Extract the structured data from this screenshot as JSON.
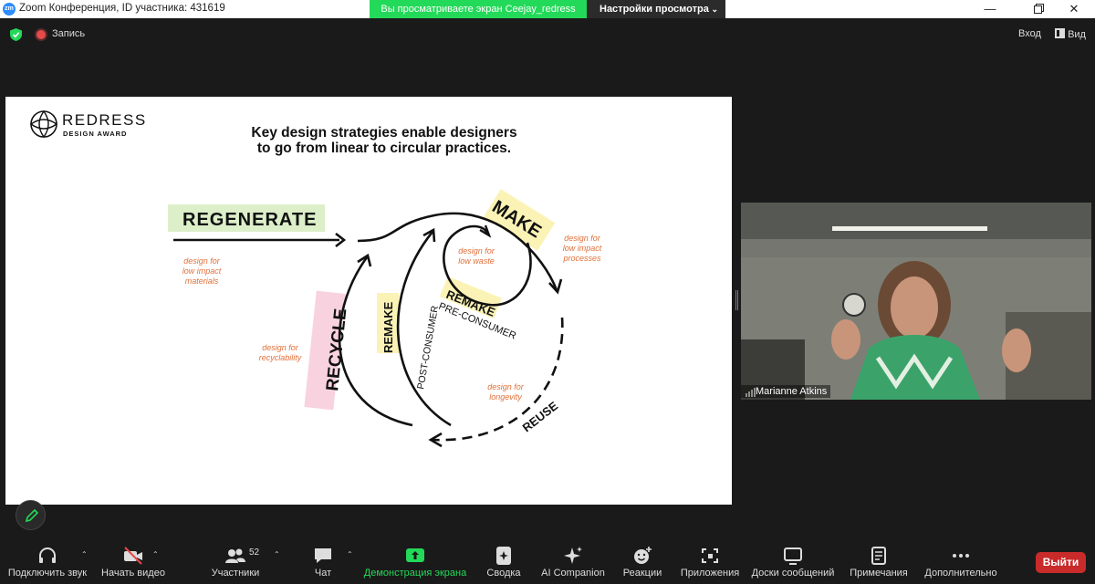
{
  "window": {
    "app_logo": "zm",
    "title": "Zoom Конференция, ID участника: 431619",
    "share_banner": "Вы просматриваете экран Ceejay_redress",
    "view_settings": "Настройки просмотра",
    "controls": [
      "minimize-icon",
      "restore-icon",
      "close-icon"
    ]
  },
  "meeting_bar": {
    "recording_label": "Запись",
    "signin_label": "Вход",
    "view_label": "Вид",
    "recording_color": "#e84a4a",
    "security_color": "#23d959"
  },
  "slide": {
    "logo_name": "REDRESS",
    "logo_sub": "DESIGN AWARD",
    "title_line1": "Key design strategies enable designers",
    "title_line2": "to go from linear to circular practices.",
    "labels": {
      "regenerate": "REGENERATE",
      "make": "MAKE",
      "remake_pre": "REMAKE",
      "pre_consumer": "PRE-CONSUMER",
      "remake_post": "REMAKE",
      "post_consumer": "POST-CONSUMER",
      "recycle": "RECYCLE",
      "reuse": "REUSE"
    },
    "notes": {
      "low_impact_materials_1": "design for",
      "low_impact_materials_2": "low impact",
      "low_impact_materials_3": "materials",
      "low_waste_1": "design for",
      "low_waste_2": "low waste",
      "low_impact_processes_1": "design for",
      "low_impact_processes_2": "low impact",
      "low_impact_processes_3": "processes",
      "recyclability_1": "design for",
      "recyclability_2": "recyclability",
      "longevity_1": "design for",
      "longevity_2": "longevity"
    },
    "note_color": "#e2703a",
    "highlight_green": "#d9edc3",
    "highlight_yellow": "#fbf3b5",
    "highlight_pink": "#f9d2df"
  },
  "video": {
    "participant_name": "Marianne Atkins"
  },
  "toolbar": {
    "audio": "Подключить звук",
    "video": "Начать видео",
    "participants": "Участники",
    "participants_count": "52",
    "chat": "Чат",
    "share": "Демонстрация экрана",
    "summary": "Сводка",
    "ai": "AI Companion",
    "reactions": "Реакции",
    "apps": "Приложения",
    "whiteboards": "Доски сообщений",
    "notes": "Примечания",
    "more": "Дополнительно",
    "leave": "Выйти",
    "share_color": "#23d959",
    "leave_color": "#c92a2a"
  }
}
